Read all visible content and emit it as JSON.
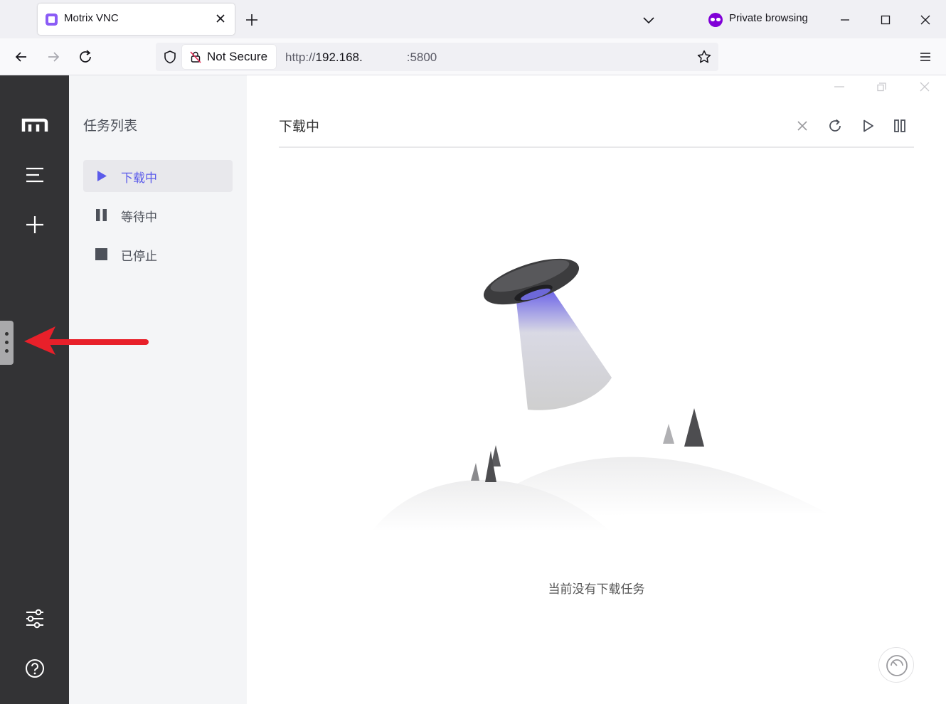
{
  "browser": {
    "tab": {
      "title": "Motrix VNC"
    },
    "private_label": "Private browsing",
    "security_label": "Not Secure",
    "url": {
      "scheme": "http://",
      "host": "192.168.",
      "port": ":5800"
    }
  },
  "sidebar": {
    "icons": [
      "motrix-logo-icon",
      "task-list-icon",
      "add-icon",
      "preferences-icon",
      "help-icon"
    ]
  },
  "subnav": {
    "title": "任务列表",
    "items": [
      {
        "label": "下载中",
        "icon": "play-icon",
        "active": true
      },
      {
        "label": "等待中",
        "icon": "pause-icon",
        "active": false
      },
      {
        "label": "已停止",
        "icon": "stop-icon",
        "active": false
      }
    ]
  },
  "main": {
    "title": "下载中",
    "toolbar": [
      "close-icon",
      "refresh-icon",
      "resume-all-icon",
      "pause-all-icon"
    ],
    "empty_text": "当前没有下载任务"
  },
  "colors": {
    "sidebar_bg": "#333335",
    "accent": "#5b5bea",
    "annotation_arrow": "#e8202a"
  }
}
